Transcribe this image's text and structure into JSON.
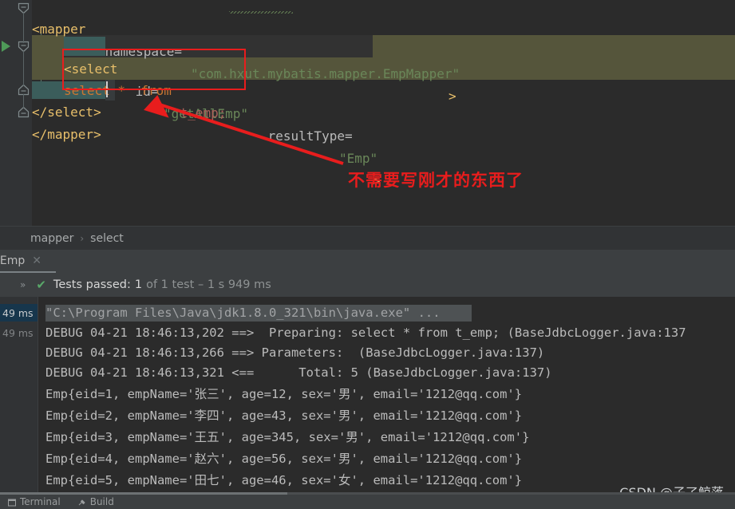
{
  "editor": {
    "lines": [
      {
        "id": "mapper-open",
        "text": "<mapper namespace=\"com.hxut.mybatis.mapper.EmpMapper\">"
      },
      {
        "id": "select-open",
        "text": "<select id=\"getAllEmp\" resultType=\"Emp\">"
      },
      {
        "id": "select-sql",
        "text": "select *  from t_emp;"
      },
      {
        "id": "select-close",
        "text": "</select>"
      },
      {
        "id": "mapper-close",
        "text": "</mapper>"
      }
    ],
    "tokens": {
      "tag_mapper_open_lt": "<mapper",
      "attr_namespace": " namespace=",
      "str_namespace": "\"com.hxut.mybatis.mapper.EmpMapper\"",
      "tag_gt": ">",
      "tag_select_open": "<select",
      "attr_id": " id=",
      "str_id": "\"getAllEmp\"",
      "attr_resulttype": " resultType=",
      "str_resulttype": "\"Emp\"",
      "sql_select": "select *  from",
      "sql_table": " t_emp;",
      "tag_select_close": "</select>",
      "tag_mapper_close": "</mapper>"
    },
    "annotation": {
      "text": "不需要写刚才的东西了",
      "box_color": "#e81d1d"
    }
  },
  "breadcrumb": {
    "items": [
      "mapper",
      "select"
    ],
    "separator": "›"
  },
  "test_tab": {
    "label": "lEmp",
    "close_glyph": "✕"
  },
  "test_result": {
    "expand_glyph": "»",
    "check_glyph": "✔",
    "label": "Tests passed:",
    "count": "1",
    "rest": "of 1 test – 1 s 949 ms"
  },
  "console": {
    "time_cells": [
      {
        "value": "49 ms",
        "selected": true
      },
      {
        "value": "49 ms",
        "selected": false
      }
    ],
    "lines": [
      {
        "text": "\"C:\\Program Files\\Java\\jdk1.8.0_321\\bin\\java.exe\" ...",
        "kind": "command"
      },
      {
        "text": "DEBUG 04-21 18:46:13,202 ==>  Preparing: select * from t_emp; (BaseJdbcLogger.java:137",
        "kind": "log"
      },
      {
        "text": "DEBUG 04-21 18:46:13,266 ==> Parameters:  (BaseJdbcLogger.java:137)",
        "kind": "log"
      },
      {
        "text": "DEBUG 04-21 18:46:13,321 <==      Total: 5 (BaseJdbcLogger.java:137)",
        "kind": "log"
      },
      {
        "text": "Emp{eid=1, empName='张三', age=12, sex='男', email='1212@qq.com'}",
        "kind": "log"
      },
      {
        "text": "Emp{eid=2, empName='李四', age=43, sex='男', email='1212@qq.com'}",
        "kind": "log"
      },
      {
        "text": "Emp{eid=3, empName='王五', age=345, sex='男', email='1212@qq.com'}",
        "kind": "log"
      },
      {
        "text": "Emp{eid=4, empName='赵六', age=56, sex='男', email='1212@qq.com'}",
        "kind": "log"
      },
      {
        "text": "Emp{eid=5, empName='田七', age=46, sex='女', email='1212@qq.com'}",
        "kind": "log"
      }
    ]
  },
  "statusbar": {
    "terminal": "Terminal",
    "build": "Build"
  },
  "watermark": "CSDN @子了鲸落"
}
